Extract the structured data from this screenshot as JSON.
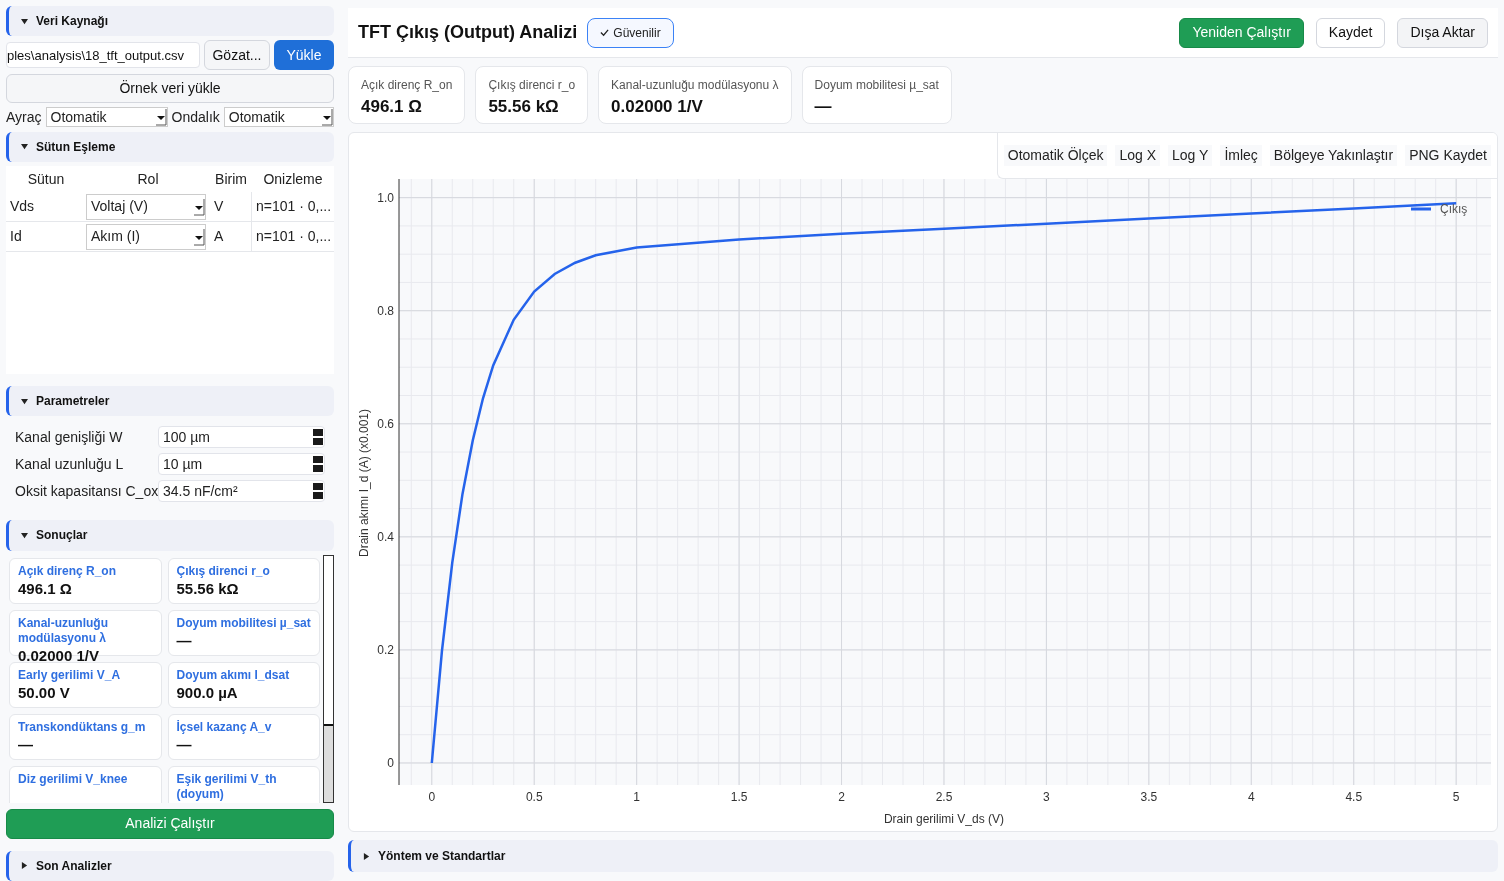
{
  "sidebar": {
    "data_source": {
      "title": "Veri Kaynağı",
      "expanded": true,
      "file_path": "ples\\analysis\\18_tft_output.csv",
      "browse_button": "Gözat...",
      "load_button": "Yükle",
      "sample_button": "Örnek veri yükle",
      "separator": {
        "label": "Ayraç",
        "value": "Otomatik"
      },
      "decimal": {
        "label": "Ondalık",
        "value": "Otomatik"
      }
    },
    "column_mapping": {
      "title": "Sütun Eşleme",
      "expanded": true,
      "columns": [
        "Sütun",
        "Rol",
        "Birim",
        "Onizleme"
      ],
      "rows": [
        {
          "column": "Vds",
          "role": "Voltaj (V)",
          "unit": "V",
          "preview": "n=101 · 0,..."
        },
        {
          "column": "Id",
          "role": "Akım (I)",
          "unit": "A",
          "preview": "n=101 · 0,..."
        }
      ]
    },
    "parameters": {
      "title": "Parametreler",
      "expanded": true,
      "fields": [
        {
          "label": "Kanal genişliği W",
          "value": "100 µm"
        },
        {
          "label": "Kanal uzunluğu L",
          "value": "10 µm"
        },
        {
          "label": "Oksit kapasitansı C_ox",
          "value": "34.5 nF/cm²"
        }
      ]
    },
    "results": {
      "title": "Sonuçlar",
      "expanded": true,
      "cards": [
        {
          "label": "Açık direnç R_on",
          "value": "496.1 Ω"
        },
        {
          "label": "Çıkış direnci r_o",
          "value": "55.56 kΩ"
        },
        {
          "label": "Kanal-uzunluğu modülasyonu λ",
          "value": "0.02000 1/V"
        },
        {
          "label": "Doyum mobilitesi µ_sat",
          "value": "—"
        },
        {
          "label": "Early gerilimi V_A",
          "value": "50.00 V"
        },
        {
          "label": "Doyum akımı I_dsat",
          "value": "900.0 µA"
        },
        {
          "label": "Transkondüktans g_m",
          "value": "—"
        },
        {
          "label": "İçsel kazanç A_v",
          "value": "—"
        },
        {
          "label": "Diz gerilimi V_knee"
        },
        {
          "label": "Eşik gerilimi V_th (doyum)"
        }
      ]
    },
    "run_button": "Analizi Çalıştır",
    "recent": {
      "title": "Son Analizler",
      "expanded": false
    }
  },
  "header": {
    "title": "TFT Çıkış (Output) Analizi",
    "badge": "Güvenilir",
    "actions": [
      {
        "label": "Yeniden Çalıştır",
        "kind": "primary"
      },
      {
        "label": "Kaydet",
        "kind": "outline"
      },
      {
        "label": "Dışa Aktar",
        "kind": "secondary"
      }
    ]
  },
  "kpis": [
    {
      "label": "Açık direnç R_on",
      "value": "496.1 Ω"
    },
    {
      "label": "Çıkış direnci r_o",
      "value": "55.56 kΩ"
    },
    {
      "label": "Kanal-uzunluğu modülasyonu λ",
      "value": "0.02000 1/V"
    },
    {
      "label": "Doyum mobilitesi µ_sat",
      "value": "—"
    }
  ],
  "chart_toolbar": [
    "Otomatik Ölçek",
    "Log X",
    "Log Y",
    "İmleç",
    "Bölgeye Yakınlaştır",
    "PNG Kaydet"
  ],
  "chart_data": {
    "type": "line",
    "xlabel": "Drain gerilimi V_ds (V)",
    "ylabel": "Drain akımı I_d (A) (x0.001)",
    "x": [
      0,
      0.05,
      0.1,
      0.15,
      0.2,
      0.25,
      0.3,
      0.4,
      0.5,
      0.6,
      0.7,
      0.8,
      1,
      1.5,
      2,
      2.5,
      3,
      3.5,
      4,
      4.5,
      5
    ],
    "series": [
      {
        "name": "Çıkış",
        "color": "#2563eb",
        "values": [
          0,
          0.199,
          0.355,
          0.476,
          0.571,
          0.645,
          0.703,
          0.784,
          0.834,
          0.865,
          0.885,
          0.898,
          0.912,
          0.926,
          0.936,
          0.945,
          0.954,
          0.963,
          0.972,
          0.981,
          0.99
        ]
      }
    ],
    "grid": true,
    "xlim": [
      -0.16,
      5.17
    ],
    "ylim": [
      -0.039,
      1.033
    ],
    "xticks": [
      0,
      0.5,
      1,
      1.5,
      2,
      2.5,
      3,
      3.5,
      4,
      4.5,
      5
    ],
    "yticks": [
      0,
      0.2,
      0.4,
      0.6,
      0.8,
      {
        "value": 1,
        "label": "1.0"
      }
    ]
  },
  "methods": {
    "title": "Yöntem ve Standartlar",
    "expanded": false
  }
}
